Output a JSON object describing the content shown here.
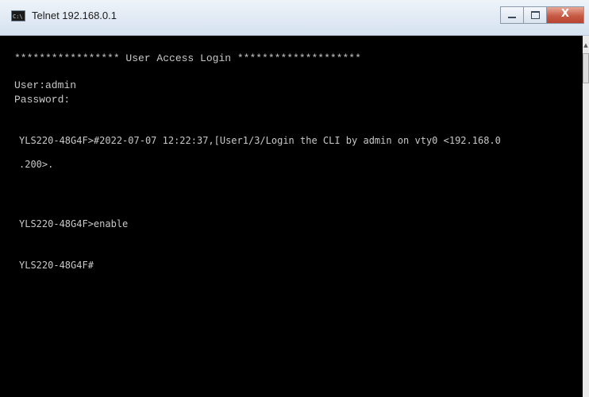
{
  "window": {
    "title": "Telnet 192.168.0.1",
    "app_icon_text": "C:\\",
    "controls": {
      "close_glyph": "X"
    }
  },
  "console": {
    "banner": "***************** User Access Login ********************",
    "user_line": "User:admin",
    "password_line": "Password:",
    "log_line_1": "YLS220-48G4F>#2022-07-07 12:22:37,[User1/3/Login the CLI by admin on vty0 <192.168.0",
    "log_line_2": ".200>.",
    "enable_line": "YLS220-48G4F>enable",
    "prompt_line": "YLS220-48G4F#"
  },
  "colors": {
    "console_bg": "#000000",
    "console_text": "#c8c8c8",
    "close_button": "#c75b45"
  }
}
